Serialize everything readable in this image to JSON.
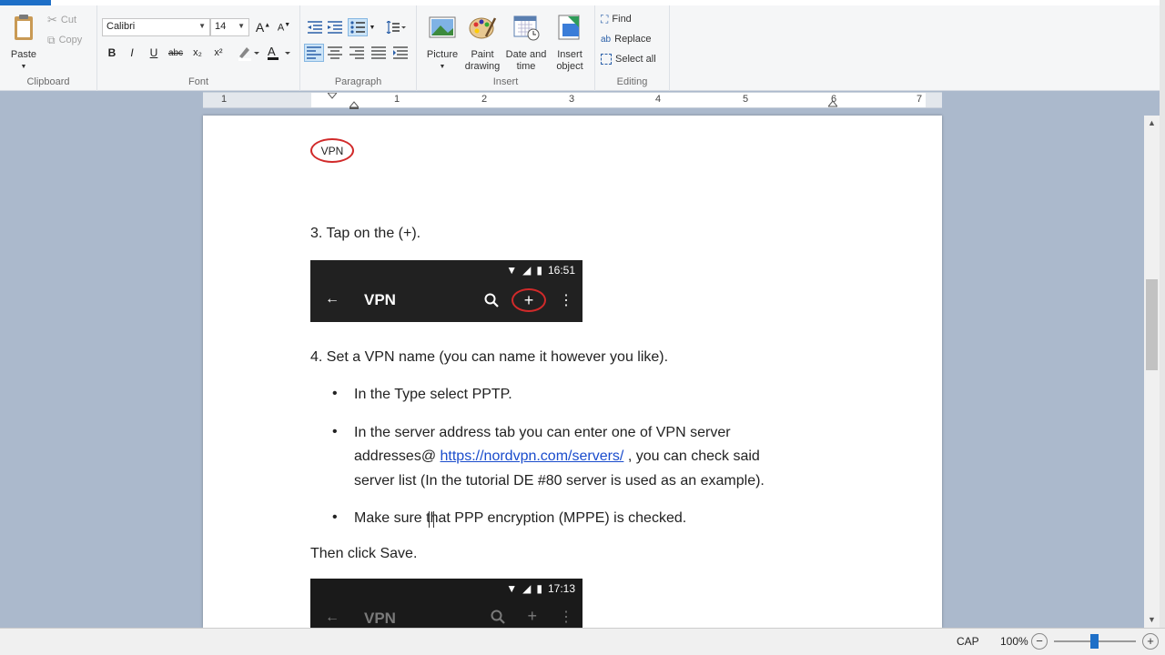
{
  "ribbon": {
    "clipboard": {
      "paste": "Paste",
      "cut": "Cut",
      "copy": "Copy",
      "label": "Clipboard"
    },
    "font": {
      "family": "Calibri",
      "size": "14",
      "label": "Font",
      "bold": "B",
      "italic": "I",
      "underline": "U",
      "strike": "abc",
      "subscript": "x₂",
      "superscript": "x²"
    },
    "paragraph": {
      "label": "Paragraph"
    },
    "insert": {
      "picture": "Picture",
      "paint_line1": "Paint",
      "paint_line2": "drawing",
      "date_line1": "Date and",
      "date_line2": "time",
      "object_line1": "Insert",
      "object_line2": "object",
      "label": "Insert"
    },
    "editing": {
      "find": "Find",
      "replace": "Replace",
      "select_all": "Select all",
      "label": "Editing"
    }
  },
  "ruler": {
    "numbers": [
      "1",
      "1",
      "2",
      "3",
      "4",
      "5",
      "6",
      "7"
    ]
  },
  "document": {
    "vpn_label": "VPN",
    "step3": "3. Tap on the (+).",
    "phone1": {
      "time": "16:51",
      "title": "VPN"
    },
    "step4": "4. Set a VPN name (you can name it however you like).",
    "bullet1": "In the Type select PPTP.",
    "bullet2_line1": "In the server address tab you can enter one of VPN server",
    "bullet2_line2_pre": "addresses@ ",
    "bullet2_link": "https://nordvpn.com/servers/",
    "bullet2_line2_post": " , you can check said",
    "bullet2_line3": "server list (In the tutorial DE #80 server is used as an example).",
    "bullet3": "Make sure that PPP encryption (MPPE) is checked.",
    "then": "Then click Save.",
    "phone2": {
      "time": "17:13",
      "title": "VPN"
    }
  },
  "statusbar": {
    "cap": "CAP",
    "zoom": "100%",
    "zoom_minus": "−",
    "zoom_plus": "+",
    "zoom_level_pct": 45
  }
}
